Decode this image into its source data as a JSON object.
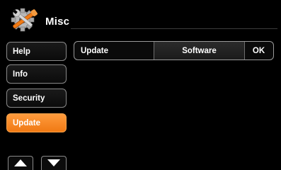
{
  "header": {
    "title": "Misc",
    "logo_icon": "settings-tools-icon"
  },
  "sidebar": {
    "items": [
      {
        "label": "Help",
        "active": false
      },
      {
        "label": "Info",
        "active": false
      },
      {
        "label": "Security",
        "active": false
      },
      {
        "label": "Update",
        "active": true
      }
    ],
    "scroll": {
      "up_icon": "triangle-up-icon",
      "down_icon": "triangle-down-icon"
    }
  },
  "content": {
    "row": {
      "label": "Update",
      "value": "Software",
      "confirm": "OK"
    }
  },
  "colors": {
    "accent": "#f07a14",
    "background": "#000000",
    "border": "#8a8a8a"
  }
}
